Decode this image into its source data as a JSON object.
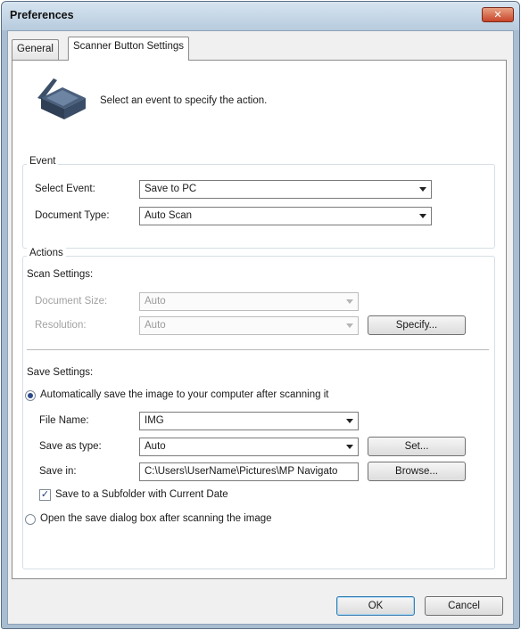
{
  "window": {
    "title": "Preferences",
    "close_label": "✕"
  },
  "tabs": [
    {
      "label": "General"
    },
    {
      "label": "Scanner Button Settings"
    }
  ],
  "header": {
    "instruction": "Select an event to specify the action."
  },
  "event_group": {
    "title": "Event",
    "select_event_label": "Select Event:",
    "select_event_value": "Save to PC",
    "document_type_label": "Document Type:",
    "document_type_value": "Auto Scan"
  },
  "actions_group": {
    "title": "Actions",
    "scan_settings_label": "Scan Settings:",
    "document_size_label": "Document Size:",
    "document_size_value": "Auto",
    "resolution_label": "Resolution:",
    "resolution_value": "Auto",
    "specify_label": "Specify...",
    "save_settings_label": "Save Settings:",
    "auto_save_label": "Automatically save the image to your computer after scanning it",
    "file_name_label": "File Name:",
    "file_name_value": "IMG",
    "save_as_type_label": "Save as type:",
    "save_as_type_value": "Auto",
    "set_label": "Set...",
    "save_in_label": "Save in:",
    "save_in_value": "C:\\Users\\UserName\\Pictures\\MP Navigato",
    "browse_label": "Browse...",
    "subfolder_label": "Save to a Subfolder with Current Date",
    "subfolder_checked": true,
    "open_dialog_label": "Open the save dialog box after scanning the image"
  },
  "footer": {
    "ok_label": "OK",
    "cancel_label": "Cancel"
  },
  "colors": {
    "titlebar": "#b7cbde",
    "close": "#c8452a",
    "frame": "#a9bdd1",
    "icon": "#3c4f68"
  }
}
